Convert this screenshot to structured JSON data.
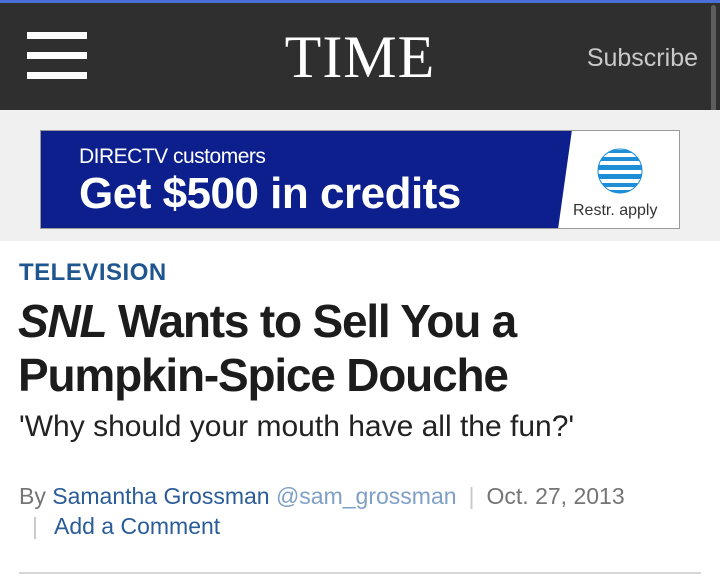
{
  "header": {
    "logo": "TIME",
    "subscribe_label": "Subscribe"
  },
  "ad": {
    "line1": "DIRECTV customers",
    "line2": "Get $500 in credits",
    "fine_print": "Restr. apply",
    "brand_color": "#0c1f8c"
  },
  "article": {
    "category": "TELEVISION",
    "headline_italic": "SNL",
    "headline_rest": " Wants to Sell You a Pumpkin-Spice Douche",
    "dek": "'Why should your mouth have all the fun?'",
    "byline_prefix": "By ",
    "author": "Samantha Grossman",
    "handle": "@sam_grossman",
    "separator": "|",
    "date": "Oct. 27, 2013",
    "comment_label": "Add a Comment"
  },
  "colors": {
    "header_bg": "#2f2f2f",
    "link_blue": "#2a5c98",
    "category_blue": "#20568f"
  }
}
